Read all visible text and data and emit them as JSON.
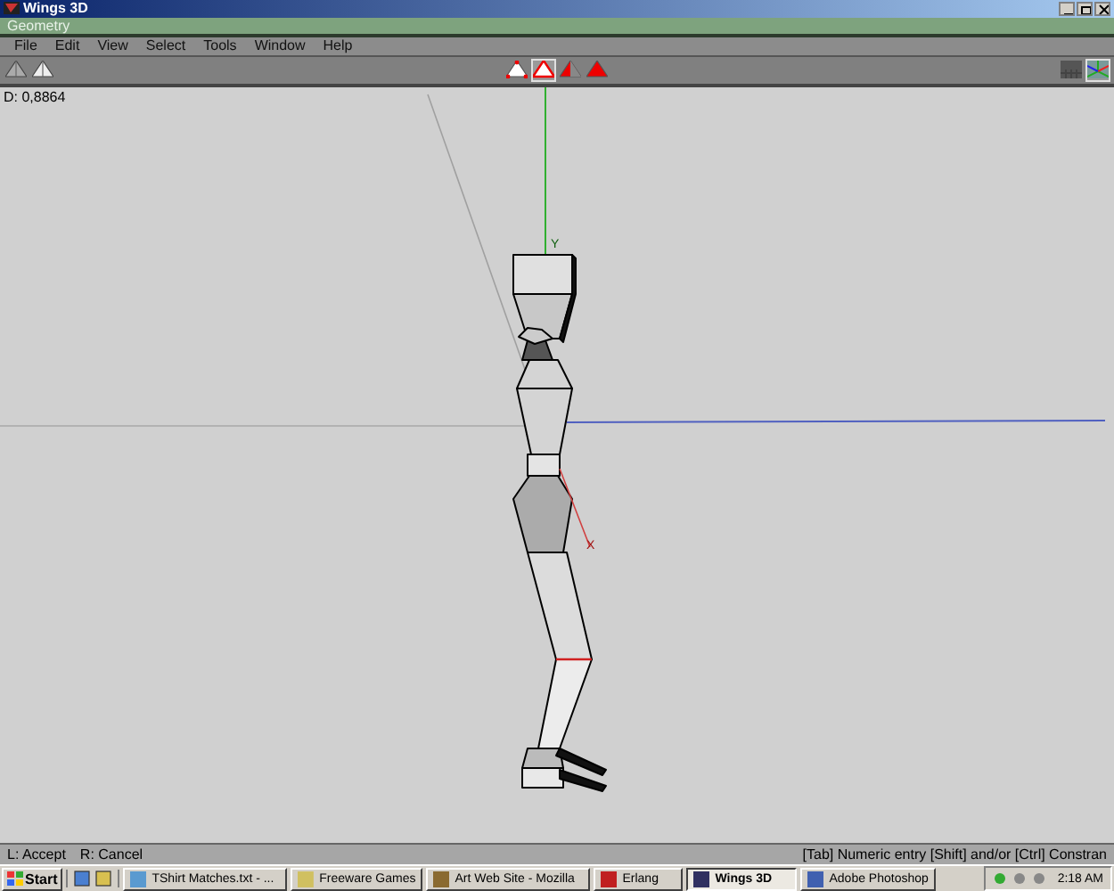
{
  "window": {
    "title": "Wings 3D"
  },
  "geometry_bar": {
    "title": "Geometry"
  },
  "menu": [
    "File",
    "Edit",
    "View",
    "Select",
    "Tools",
    "Window",
    "Help"
  ],
  "select_modes": [
    {
      "kind": "vertex",
      "selected": false
    },
    {
      "kind": "edge",
      "selected": true
    },
    {
      "kind": "face",
      "selected": false
    },
    {
      "kind": "body",
      "selected": false
    }
  ],
  "view_toggles": [
    {
      "kind": "groundplane",
      "on": false
    },
    {
      "kind": "axes",
      "on": true
    }
  ],
  "viewport": {
    "readout": "D: 0,8864",
    "axis_labels": [
      "Y",
      "X"
    ]
  },
  "status_bar": {
    "left": [
      "L: Accept",
      "R: Cancel"
    ],
    "right": "[Tab] Numeric entry  [Shift] and/or  [Ctrl] Constran"
  },
  "taskbar": {
    "start": "Start",
    "tasks": [
      {
        "label": "TShirt Matches.txt - ...",
        "selected": false
      },
      {
        "label": "Freeware Games",
        "selected": false
      },
      {
        "label": "Art Web Site - Mozilla",
        "selected": false
      },
      {
        "label": "Erlang",
        "selected": false
      },
      {
        "label": "Wings 3D",
        "selected": true
      },
      {
        "label": "Adobe Photoshop",
        "selected": false
      }
    ],
    "clock": "2:18 AM"
  }
}
